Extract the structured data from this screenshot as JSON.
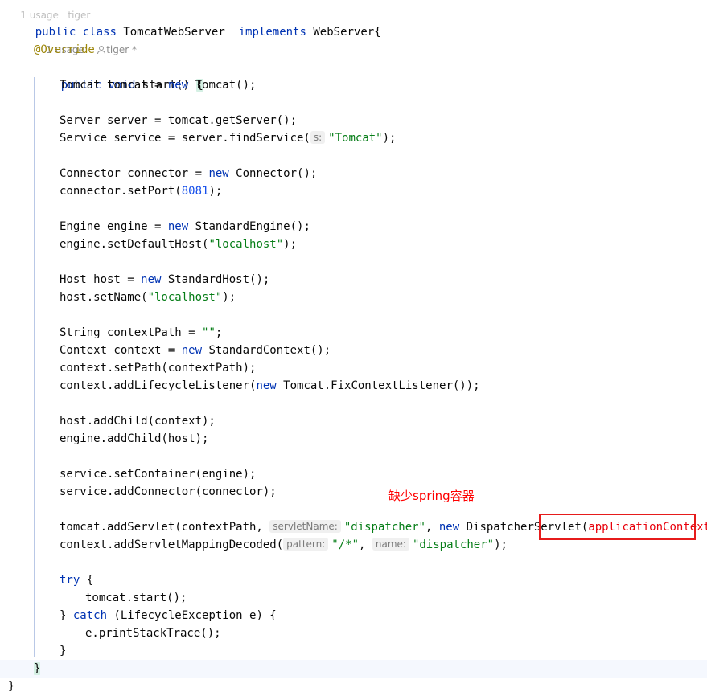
{
  "top_meta": {
    "usages": "1 usage",
    "author": "tiger"
  },
  "class_decl": {
    "public": "public",
    "class": "class",
    "name": "TomcatWebServer",
    "implements": "implements",
    "iface": "WebServer",
    "open": "{"
  },
  "method_meta": {
    "usages": "1 usage",
    "author": "tiger *"
  },
  "annotation": "@Override",
  "method_decl": {
    "public": "public",
    "void": "void",
    "name": "start() ",
    "brace": "{"
  },
  "code": {
    "l1": {
      "a": "Tomcat tomcat = ",
      "new": "new",
      "b": " Tomcat();"
    },
    "l2": {
      "a": "Server server = tomcat.getServer();"
    },
    "l3": {
      "a": "Service service = server.findService(",
      "hint": "s:",
      "str": "\"Tomcat\"",
      "b": ");"
    },
    "l4": {
      "a": "Connector connector = ",
      "new": "new",
      "b": " Connector();"
    },
    "l5": {
      "a": "connector.setPort(",
      "num": "8081",
      "b": ");"
    },
    "l6": {
      "a": "Engine engine = ",
      "new": "new",
      "b": " StandardEngine();"
    },
    "l7": {
      "a": "engine.setDefaultHost(",
      "str": "\"localhost\"",
      "b": ");"
    },
    "l8": {
      "a": "Host host = ",
      "new": "new",
      "b": " StandardHost();"
    },
    "l9": {
      "a": "host.setName(",
      "str": "\"localhost\"",
      "b": ");"
    },
    "l10": {
      "a": "String contextPath = ",
      "str": "\"\"",
      "b": ";"
    },
    "l11": {
      "a": "Context context = ",
      "new": "new",
      "b": " StandardContext();"
    },
    "l12": {
      "a": "context.setPath(contextPath);"
    },
    "l13": {
      "a": "context.addLifecycleListener(",
      "new": "new",
      "b": " Tomcat.FixContextListener());"
    },
    "l14": {
      "a": "host.addChild(context);"
    },
    "l15": {
      "a": "engine.addChild(host);"
    },
    "l16": {
      "a": "service.setContainer(engine);"
    },
    "l17": {
      "a": "service.addConnector(connector);"
    },
    "l18": {
      "a": "tomcat.addServlet(contextPath, ",
      "hint": "servletName:",
      "str": "\"dispatcher\"",
      "mid": ", ",
      "new": "new",
      "b": " DispatcherServlet(",
      "err": "applicationContext",
      "c": "));"
    },
    "l19": {
      "a": "context.addServletMappingDecoded(",
      "hint1": "pattern:",
      "str1": "\"/*\"",
      "mid": ", ",
      "hint2": "name:",
      "str2": "\"dispatcher\"",
      "b": ");"
    },
    "l20": {
      "try": "try",
      "b": " {"
    },
    "l21": {
      "a": "tomcat.start();"
    },
    "l22": {
      "a": "} ",
      "catch": "catch",
      "b": " (LifecycleException e) {"
    },
    "l23": {
      "a": "e.printStackTrace();"
    },
    "l24": {
      "a": "}"
    }
  },
  "method_close": "}",
  "class_close": "}",
  "annotation_note": "缺少spring容器",
  "colors": {
    "keyword": "#0033b3",
    "string": "#067d17",
    "number": "#1750eb",
    "annotation": "#9e880d",
    "error": "#e8000b",
    "highlight": "#e61b1b"
  }
}
